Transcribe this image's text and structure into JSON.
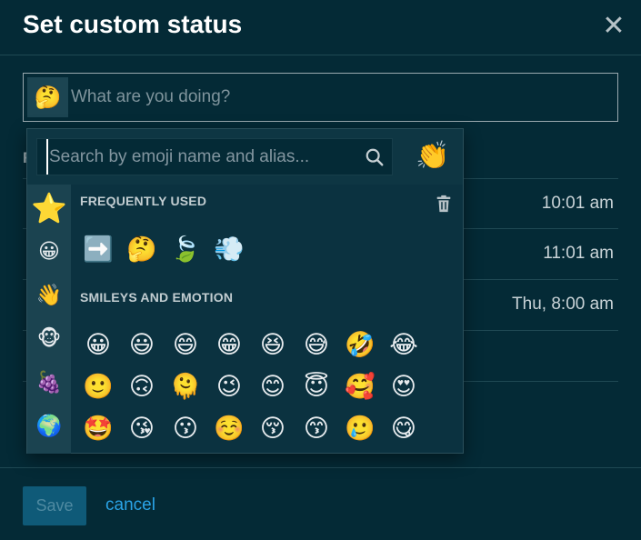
{
  "dialog": {
    "title": "Set custom status",
    "close_icon": "close-icon"
  },
  "status": {
    "emoji": "🤔",
    "placeholder": "What are you doing?"
  },
  "presets": {
    "label": "R",
    "rows": [
      {
        "time": "10:01 am"
      },
      {
        "time": "11:01 am"
      },
      {
        "time": "Thu, 8:00 am"
      },
      {
        "time": ""
      }
    ]
  },
  "picker": {
    "search_placeholder": "Search by emoji name and alias...",
    "search_icon": "search-icon",
    "skin_tone_emoji": "👏",
    "categories": [
      {
        "name": "frequently-used",
        "glyph": "⭐"
      },
      {
        "name": "smileys",
        "glyph": "😀"
      },
      {
        "name": "people",
        "glyph": "👋"
      },
      {
        "name": "animals",
        "glyph": "🐵"
      },
      {
        "name": "food",
        "glyph": "🍇"
      },
      {
        "name": "travel",
        "glyph": "🌍"
      }
    ],
    "frequently_used_title": "FREQUENTLY USED",
    "trash_icon": "trash-icon",
    "frequently_used": [
      "➡️",
      "🤔",
      "🍃",
      "💨"
    ],
    "smileys_title": "SMILEYS AND EMOTION",
    "smileys": [
      [
        "😀",
        "😃",
        "😄",
        "😁",
        "😆",
        "😅",
        "🤣",
        "😂"
      ],
      [
        "🙂",
        "🙃",
        "🫠",
        "😉",
        "😊",
        "😇",
        "🥰",
        "😍"
      ],
      [
        "🤩",
        "😘",
        "😗",
        "☺️",
        "😚",
        "😙",
        "🥲",
        "😋"
      ]
    ]
  },
  "footer": {
    "save_label": "Save",
    "cancel_label": "cancel"
  }
}
